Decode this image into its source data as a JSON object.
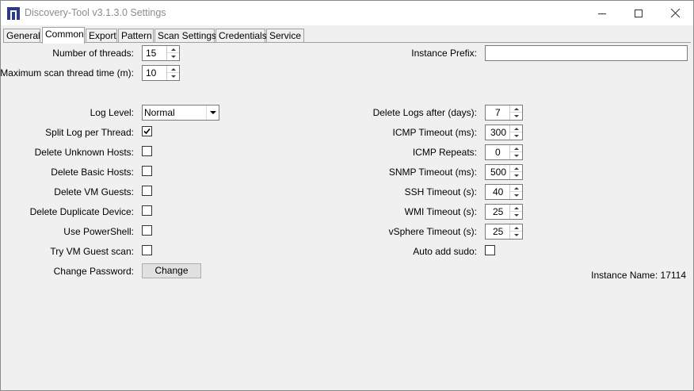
{
  "window": {
    "title": "Discovery-Tool v3.1.3.0 Settings",
    "controls": {
      "minimize": "minimize-icon",
      "maximize": "maximize-icon",
      "close": "close-icon"
    }
  },
  "tabs": [
    {
      "label": "General",
      "active": false
    },
    {
      "label": "Common",
      "active": true
    },
    {
      "label": "Export",
      "active": false
    },
    {
      "label": "Pattern",
      "active": false
    },
    {
      "label": "Scan Settings",
      "active": false
    },
    {
      "label": "Credentials",
      "active": false
    },
    {
      "label": "Service",
      "active": false
    }
  ],
  "left": {
    "threads": {
      "label": "Number of threads:",
      "value": "15"
    },
    "max_scan_time": {
      "label": "Maximum scan thread time (m):",
      "value": "10"
    },
    "log_level": {
      "label": "Log Level:",
      "value": "Normal"
    },
    "split_log": {
      "label": "Split Log per Thread:",
      "checked": true
    },
    "delete_unknown": {
      "label": "Delete Unknown Hosts:",
      "checked": false
    },
    "delete_basic": {
      "label": "Delete Basic Hosts:",
      "checked": false
    },
    "delete_vm": {
      "label": "Delete VM Guests:",
      "checked": false
    },
    "delete_duplicate": {
      "label": "Delete Duplicate Device:",
      "checked": false
    },
    "use_powershell": {
      "label": "Use PowerShell:",
      "checked": false
    },
    "try_vm_scan": {
      "label": "Try VM Guest scan:",
      "checked": false
    },
    "change_password": {
      "label": "Change Password:",
      "button": "Change"
    }
  },
  "right": {
    "instance_prefix": {
      "label": "Instance Prefix:",
      "value": ""
    },
    "delete_logs": {
      "label": "Delete Logs after (days):",
      "value": "7"
    },
    "icmp_timeout": {
      "label": "ICMP Timeout (ms):",
      "value": "300"
    },
    "icmp_repeats": {
      "label": "ICMP Repeats:",
      "value": "0"
    },
    "snmp_timeout": {
      "label": "SNMP Timeout (ms):",
      "value": "500"
    },
    "ssh_timeout": {
      "label": "SSH Timeout (s):",
      "value": "40"
    },
    "wmi_timeout": {
      "label": "WMI Timeout (s):",
      "value": "25"
    },
    "vsphere_timeout": {
      "label": "vSphere Timeout (s):",
      "value": "25"
    },
    "auto_sudo": {
      "label": "Auto add sudo:",
      "checked": false
    },
    "instance_name": "Instance Name: 17114"
  }
}
